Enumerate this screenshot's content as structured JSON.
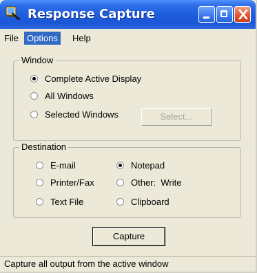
{
  "window": {
    "title": "Response Capture",
    "controls": {
      "minimize": "minimize-icon",
      "maximize": "maximize-icon",
      "close": "close-icon"
    }
  },
  "menu": [
    {
      "label": "File",
      "active": false
    },
    {
      "label": "Options",
      "active": true
    },
    {
      "label": "Help",
      "active": false
    }
  ],
  "window_group": {
    "legend": "Window",
    "options": [
      {
        "label": "Complete Active Display",
        "selected": true
      },
      {
        "label": "All Windows",
        "selected": false
      },
      {
        "label": "Selected Windows",
        "selected": false
      }
    ],
    "select_button": {
      "label": "Select...",
      "enabled": false
    }
  },
  "destination_group": {
    "legend": "Destination",
    "options": [
      {
        "label": "E-mail",
        "selected": false
      },
      {
        "label": "Printer/Fax",
        "selected": false
      },
      {
        "label": "Text File",
        "selected": false
      },
      {
        "label": "Notepad",
        "selected": true
      },
      {
        "label": "Other:  Write",
        "selected": false
      },
      {
        "label": "Clipboard",
        "selected": false
      }
    ]
  },
  "capture_button": {
    "label": "Capture"
  },
  "status": {
    "text": "Capture all output from the active window"
  },
  "colors": {
    "titlebar": "#1f5ddc",
    "menu_highlight": "#316ac5",
    "dialog_bg": "#ece9d8"
  }
}
